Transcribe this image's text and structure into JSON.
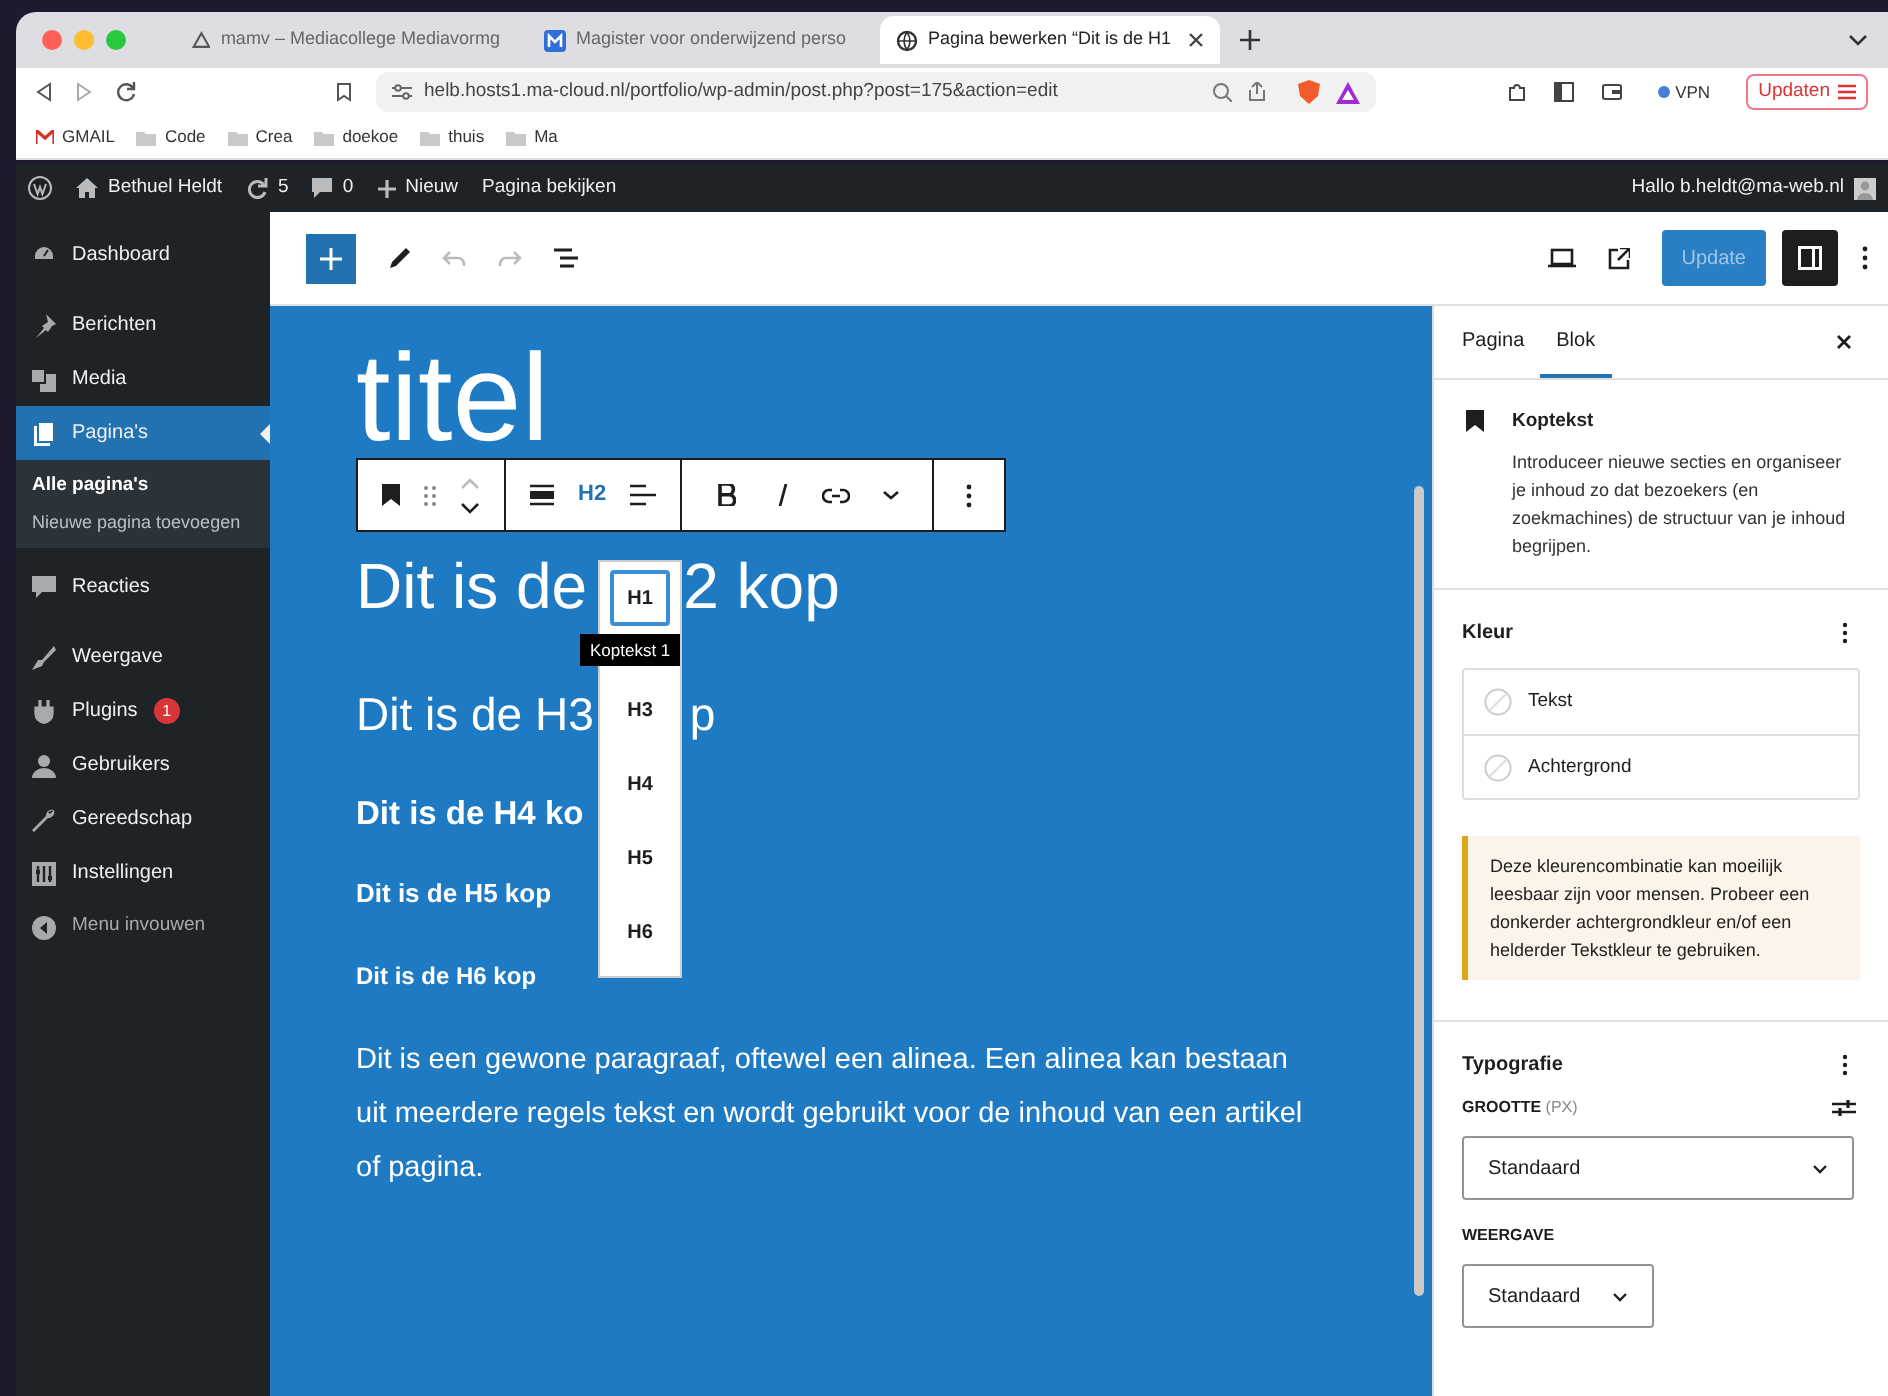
{
  "browser": {
    "tabs": [
      {
        "title": "mamv – Mediacollege Mediavormg",
        "selected": false
      },
      {
        "title": "Magister voor onderwijzend perso",
        "selected": false
      },
      {
        "title": "Pagina bewerken “Dit is de H1",
        "selected": true
      }
    ],
    "url": "helb.hosts1.ma-cloud.nl/portfolio/wp-admin/post.php?post=175&action=edit",
    "vpn": "VPN",
    "update_button": "Updaten",
    "bookmarks": [
      "GMAIL",
      "Code",
      "Crea",
      "doekoe",
      "thuis",
      "Ma"
    ]
  },
  "admin_bar": {
    "site": "Bethuel Heldt",
    "updates": "5",
    "comments": "0",
    "new": "Nieuw",
    "view": "Pagina bekijken",
    "greeting": "Hallo b.heldt@ma-web.nl"
  },
  "sidebar": {
    "items": [
      {
        "label": "Dashboard",
        "selected": false
      },
      {
        "label": "Berichten",
        "selected": false
      },
      {
        "label": "Media",
        "selected": false
      },
      {
        "label": "Pagina's",
        "selected": true,
        "children": [
          {
            "label": "Alle pagina's",
            "selected": true
          },
          {
            "label": "Nieuwe pagina toevoegen",
            "selected": false
          }
        ]
      },
      {
        "label": "Reacties",
        "selected": false
      },
      {
        "label": "Weergave",
        "selected": false
      },
      {
        "label": "Plugins",
        "selected": false,
        "badge": "1"
      },
      {
        "label": "Gebruikers",
        "selected": false
      },
      {
        "label": "Gereedschap",
        "selected": false
      },
      {
        "label": "Instellingen",
        "selected": false
      }
    ],
    "collapse": "Menu invouwen"
  },
  "editor": {
    "update_button": "Update",
    "title": "titel",
    "block_toolbar": {
      "heading_level": "H2"
    },
    "headings": [
      {
        "kind": "h2",
        "parts": [
          "Dit is de",
          "2 kop"
        ]
      },
      {
        "kind": "h3",
        "parts": [
          "Dit is de H3",
          "p"
        ]
      },
      {
        "kind": "h4",
        "parts": [
          "Dit is de H4 ko"
        ]
      },
      {
        "kind": "h5",
        "parts": [
          "Dit is de H5 kop"
        ]
      },
      {
        "kind": "h6",
        "parts": [
          "Dit is de H6 kop"
        ]
      }
    ],
    "paragraph": "Dit is een gewone paragraaf, oftewel een alinea. Een alinea kan bestaan uit meerdere regels tekst en wordt gebruikt voor de inhoud van een artikel of pagina.",
    "level_menu": {
      "items": [
        {
          "label": "H1",
          "selected": true
        },
        {
          "label": "H3",
          "selected": false
        },
        {
          "label": "H4",
          "selected": false
        },
        {
          "label": "H5",
          "selected": false
        },
        {
          "label": "H6",
          "selected": false
        }
      ],
      "tooltip": "Koptekst 1"
    }
  },
  "settings_panel": {
    "tabs": [
      {
        "label": "Pagina",
        "selected": false
      },
      {
        "label": "Blok",
        "selected": true
      }
    ],
    "block": {
      "name": "Koptekst",
      "description": "Introduceer nieuwe secties en organiseer je inhoud zo dat bezoekers (en zoekmachines) de structuur van je inhoud begrijpen."
    },
    "color": {
      "title": "Kleur",
      "options": [
        "Tekst",
        "Achtergrond"
      ],
      "warning": "Deze kleurencombinatie kan moeilijk leesbaar zijn voor mensen. Probeer een donkerder achtergrondkleur en/of een helderder Tekstkleur te gebruiken."
    },
    "typography": {
      "title": "Typografie",
      "size_label": "GROOTTE",
      "size_unit": "(PX)",
      "size_value": "Standaard",
      "appearance_label": "WEERGAVE",
      "appearance_value": "Standaard"
    }
  }
}
